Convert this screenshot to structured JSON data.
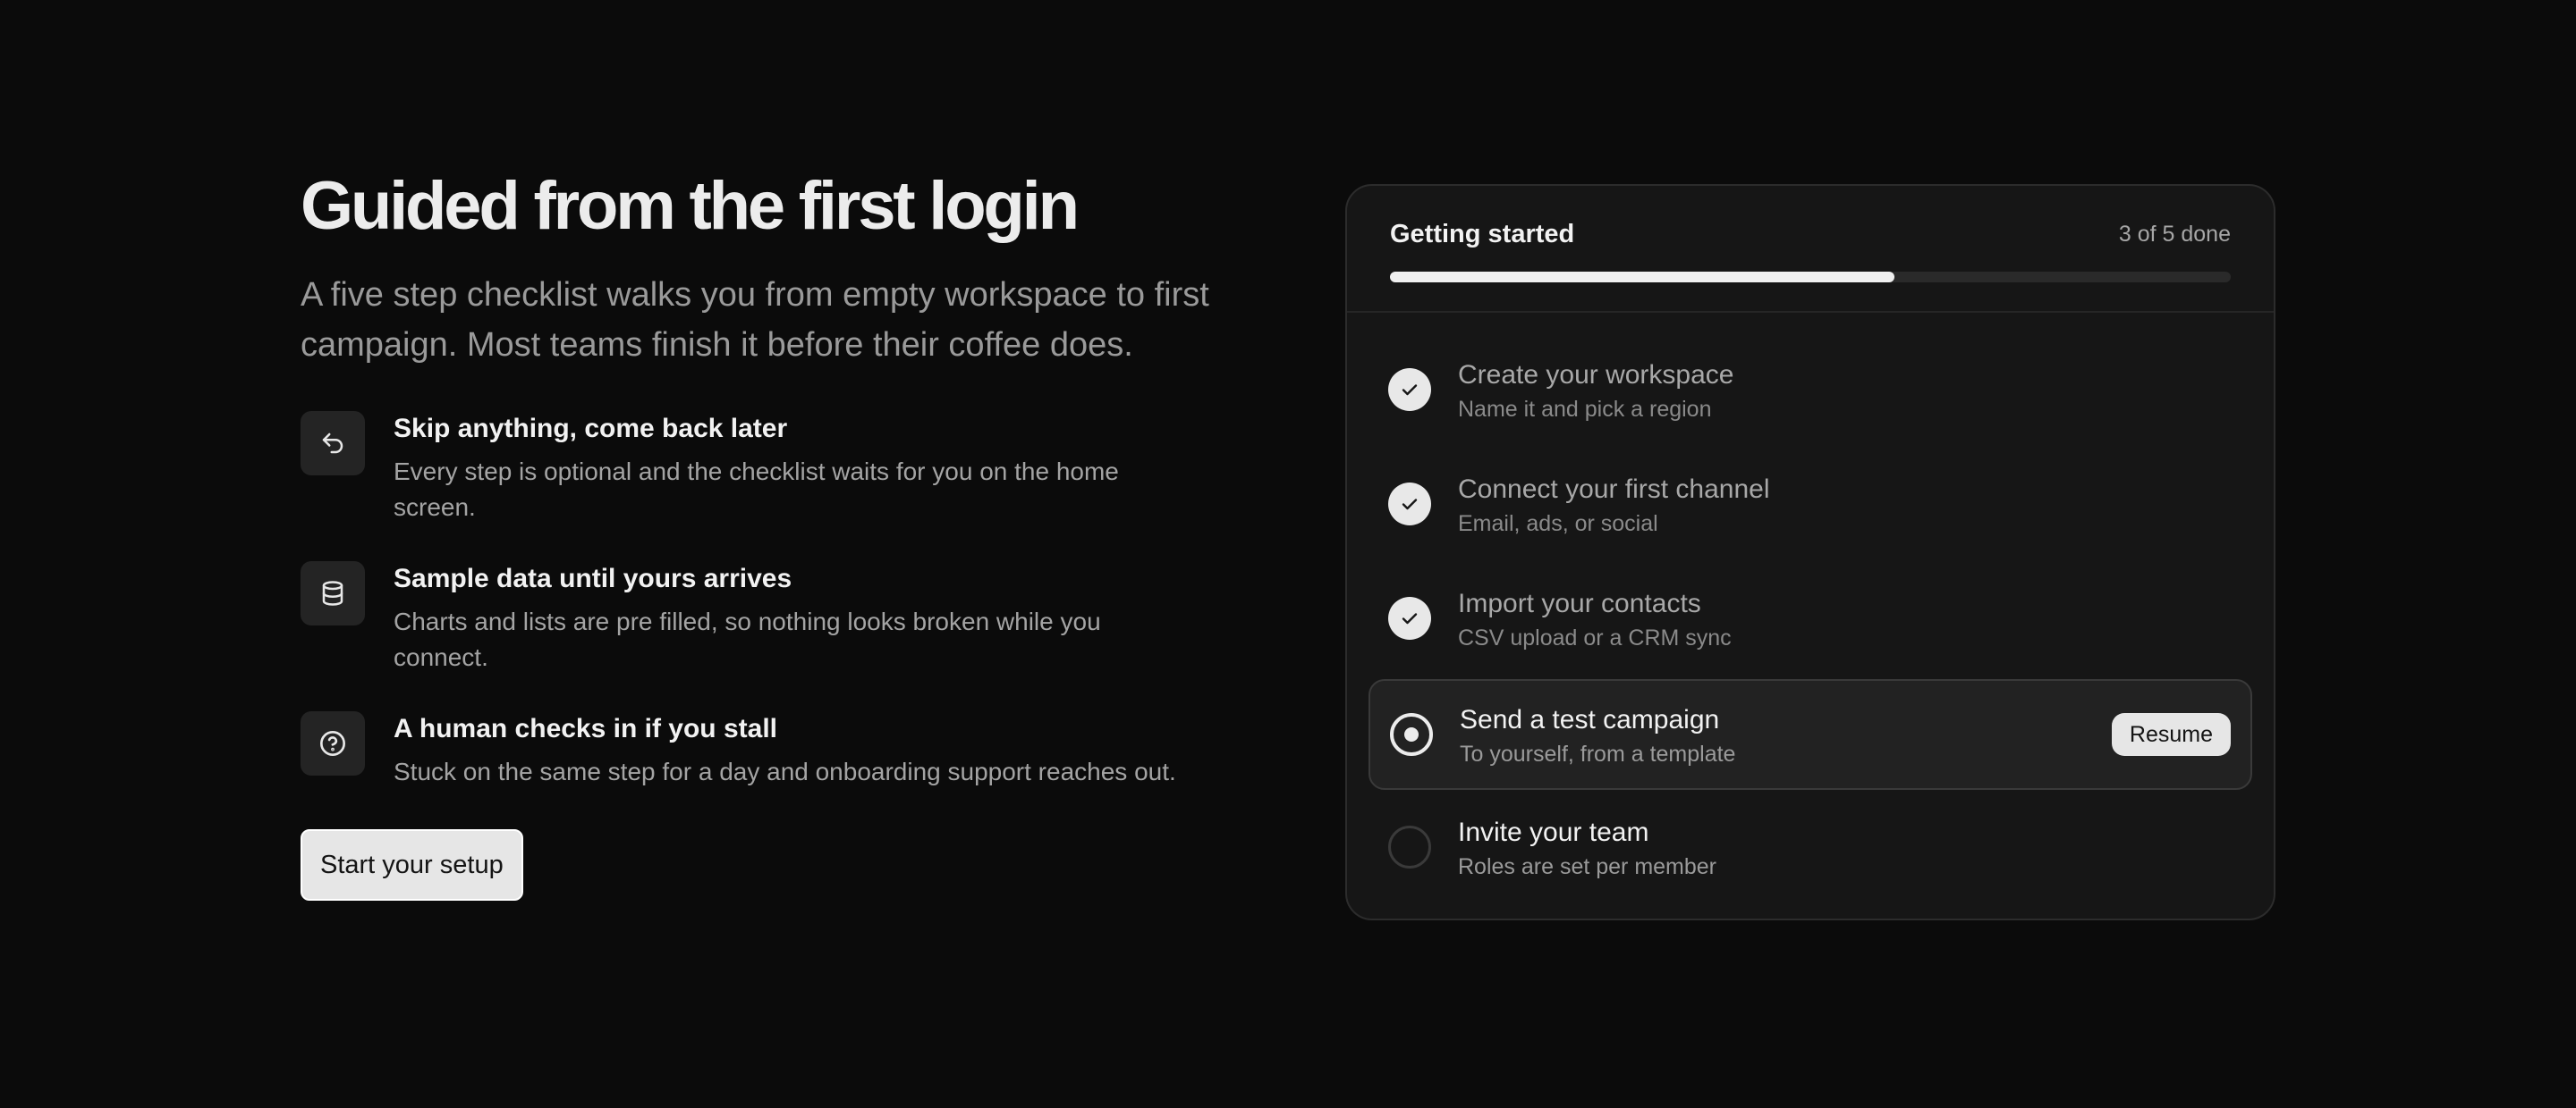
{
  "hero": {
    "headline": "Guided from the first login",
    "subhead": "A five step checklist walks you from empty workspace to first campaign. Most teams finish it before their coffee does.",
    "cta_label": "Start your setup"
  },
  "features": [
    {
      "icon": "undo-arrow-icon",
      "title": "Skip anything, come back later",
      "description": "Every step is optional and the checklist waits for you on the home screen."
    },
    {
      "icon": "database-icon",
      "title": "Sample data until yours arrives",
      "description": "Charts and lists are pre filled, so nothing looks broken while you connect."
    },
    {
      "icon": "help-circle-icon",
      "title": "A human checks in if you stall",
      "description": "Stuck on the same step for a day and onboarding support reaches out."
    }
  ],
  "checklist": {
    "title": "Getting started",
    "progress_label": "3 of 5 done",
    "progress": {
      "done": 3,
      "total": 5
    },
    "steps": [
      {
        "title": "Create your workspace",
        "subtitle": "Name it and pick a region",
        "state": "done",
        "icon": "check-icon"
      },
      {
        "title": "Connect your first channel",
        "subtitle": "Email, ads, or social",
        "state": "done",
        "icon": "check-icon"
      },
      {
        "title": "Import your contacts",
        "subtitle": "CSV upload or a CRM sync",
        "state": "done",
        "icon": "check-icon"
      },
      {
        "title": "Send a test campaign",
        "subtitle": "To yourself, from a template",
        "state": "current",
        "icon": "radio-dot-icon",
        "action_label": "Resume"
      },
      {
        "title": "Invite your team",
        "subtitle": "Roles are set per member",
        "state": "todo",
        "icon": "empty-circle-icon"
      }
    ]
  },
  "colors": {
    "background": "#0b0b0b",
    "card": "#161616",
    "accent": "#e6e6e6"
  }
}
